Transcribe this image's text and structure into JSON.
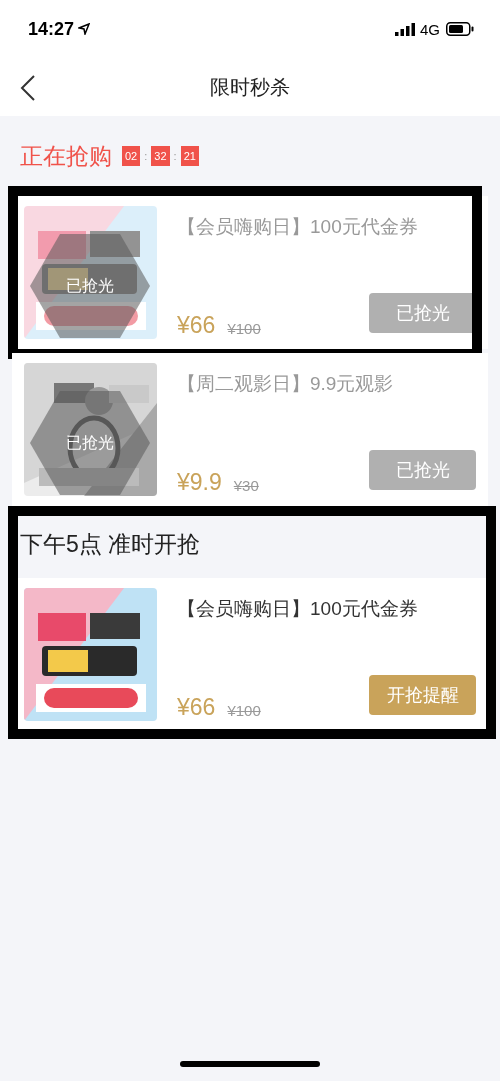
{
  "status_bar": {
    "time": "14:27",
    "network": "4G"
  },
  "nav": {
    "title": "限时秒杀"
  },
  "sections": [
    {
      "kind": "live",
      "title": "正在抢购",
      "countdown": [
        "02",
        ":",
        "32",
        ":",
        "21"
      ],
      "items": [
        {
          "title": "【会员嗨购日】100元代金券",
          "price": "¥66",
          "original_price": "¥100",
          "sold_out": true,
          "badge": "已抢光",
          "button": "已抢光",
          "outlined": true
        },
        {
          "title": "【周二观影日】9.9元观影",
          "price": "¥9.9",
          "original_price": "¥30",
          "sold_out": true,
          "badge": "已抢光",
          "button": "已抢光",
          "outlined": false
        }
      ]
    },
    {
      "kind": "upcoming",
      "title": "下午5点 准时开抢",
      "outlined": true,
      "items": [
        {
          "title": "【会员嗨购日】100元代金券",
          "price": "¥66",
          "original_price": "¥100",
          "sold_out": false,
          "button": "开抢提醒",
          "outlined": false
        }
      ]
    }
  ]
}
